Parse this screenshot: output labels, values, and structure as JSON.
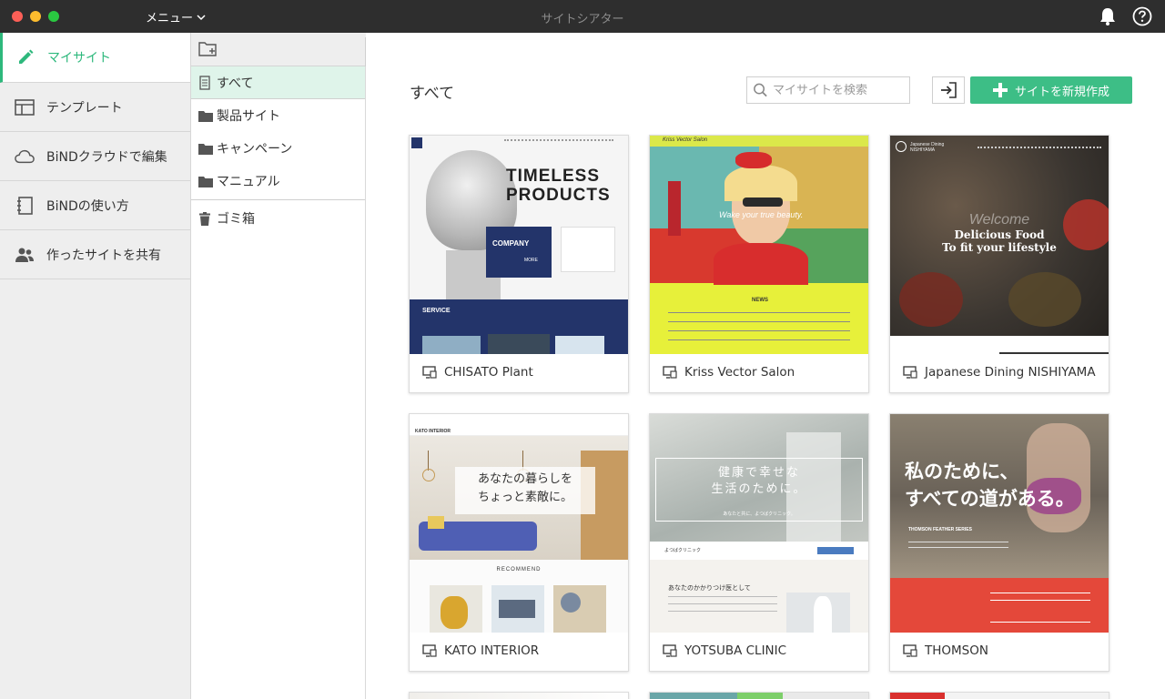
{
  "titlebar": {
    "menu_label": "メニュー",
    "window_title": "サイトシアター"
  },
  "sidebar": {
    "items": [
      {
        "label": "マイサイト",
        "icon": "pencil-icon"
      },
      {
        "label": "テンプレート",
        "icon": "template-icon"
      },
      {
        "label": "BiNDクラウドで編集",
        "icon": "cloud-icon"
      },
      {
        "label": "BiNDの使い方",
        "icon": "notebook-icon"
      },
      {
        "label": "作ったサイトを共有",
        "icon": "users-icon"
      }
    ]
  },
  "folders": {
    "items": [
      {
        "label": "すべて",
        "icon": "document-icon"
      },
      {
        "label": "製品サイト",
        "icon": "folder-icon"
      },
      {
        "label": "キャンペーン",
        "icon": "folder-icon"
      },
      {
        "label": "マニュアル",
        "icon": "folder-icon"
      }
    ],
    "trash_label": "ゴミ箱"
  },
  "main": {
    "title": "すべて",
    "search_placeholder": "マイサイトを検索",
    "new_site_label": "サイトを新規作成",
    "sites": [
      {
        "name": "CHISATO Plant"
      },
      {
        "name": "Kriss Vector Salon"
      },
      {
        "name": "Japanese Dining NISHIYAMA"
      },
      {
        "name": "KATO INTERIOR"
      },
      {
        "name": "YOTSUBA CLINIC"
      },
      {
        "name": "THOMSON"
      }
    ]
  },
  "thumbs": {
    "chisato": {
      "headline1": "TIMELESS",
      "headline2": "PRODUCTS",
      "company": "COMPANY",
      "more": "MORE",
      "service": "SERVICE"
    },
    "kriss": {
      "brand": "Kriss Vector Salon",
      "tagline": "Wake your true beauty.",
      "news": "NEWS"
    },
    "nishiyama": {
      "brand": "Japanese Dining NISHIYAMA",
      "welcome": "Welcome",
      "line1": "Delicious Food",
      "line2": "To fit your lifestyle"
    },
    "kato": {
      "brand": "KATO INTERIOR",
      "catch1": "あなたの暮らしを",
      "catch2": "ちょっと素敵に。",
      "recommend": "RECOMMEND"
    },
    "yotsuba": {
      "catch1": "健康で幸せな",
      "catch2": "生活のために。",
      "sub": "あなたと共に、よつばクリニック。",
      "clinic": "よつばクリニック",
      "heading": "あなたのかかりつけ医として"
    },
    "thomson": {
      "catch1": "私のために、",
      "catch2": "すべての道がある。",
      "series": "THOMSON FEATHER SERIES"
    }
  },
  "colors": {
    "accent": "#3dbe86",
    "titlebar": "#2e2e2e",
    "sidebar": "#eeeeee",
    "selected_folder": "#dff4ea"
  }
}
